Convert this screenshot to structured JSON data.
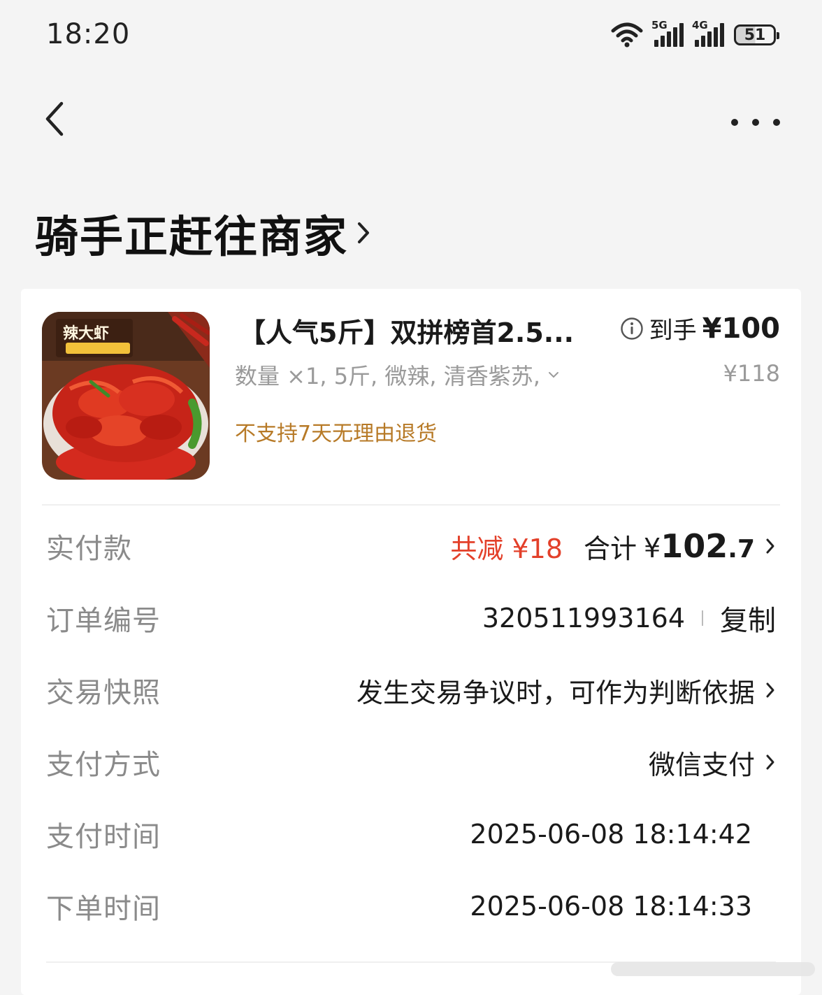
{
  "status_bar": {
    "time": "18:20",
    "signal_5g": "5G",
    "signal_4g": "4G",
    "battery": "51",
    "icons": [
      "wifi-icon",
      "signal-5g-icon",
      "signal-4g-icon",
      "battery-icon"
    ]
  },
  "nav": {
    "back_icon": "chevron-left-icon",
    "more_icon": "more-horizontal-icon"
  },
  "header": {
    "title": "骑手正赶往商家"
  },
  "product": {
    "name": "【人气5斤】双拼榜首2.5...",
    "final_price_label": "到手",
    "final_price": "¥100",
    "specs": "数量 ×1, 5斤, 微辣, 清香紫苏,",
    "original_price": "¥118",
    "return_note": "不支持7天无理由退货"
  },
  "order_info": {
    "paid": {
      "label": "实付款",
      "discount": "共减 ¥18",
      "total_label": "合计",
      "total_currency": "¥",
      "total_int": "102",
      "total_dec": ".7"
    },
    "order_no": {
      "label": "订单编号",
      "value": "320511993164",
      "copy_label": "复制"
    },
    "snapshot": {
      "label": "交易快照",
      "value": "发生交易争议时，可作为判断依据"
    },
    "payment_method": {
      "label": "支付方式",
      "value": "微信支付"
    },
    "payment_time": {
      "label": "支付时间",
      "value": "2025-06-08 18:14:42"
    },
    "order_time": {
      "label": "下单时间",
      "value": "2025-06-08 18:14:33"
    }
  },
  "colors": {
    "discount": "#e3402a",
    "return_note": "#b77a27",
    "label_gray": "#8a8a8a"
  }
}
